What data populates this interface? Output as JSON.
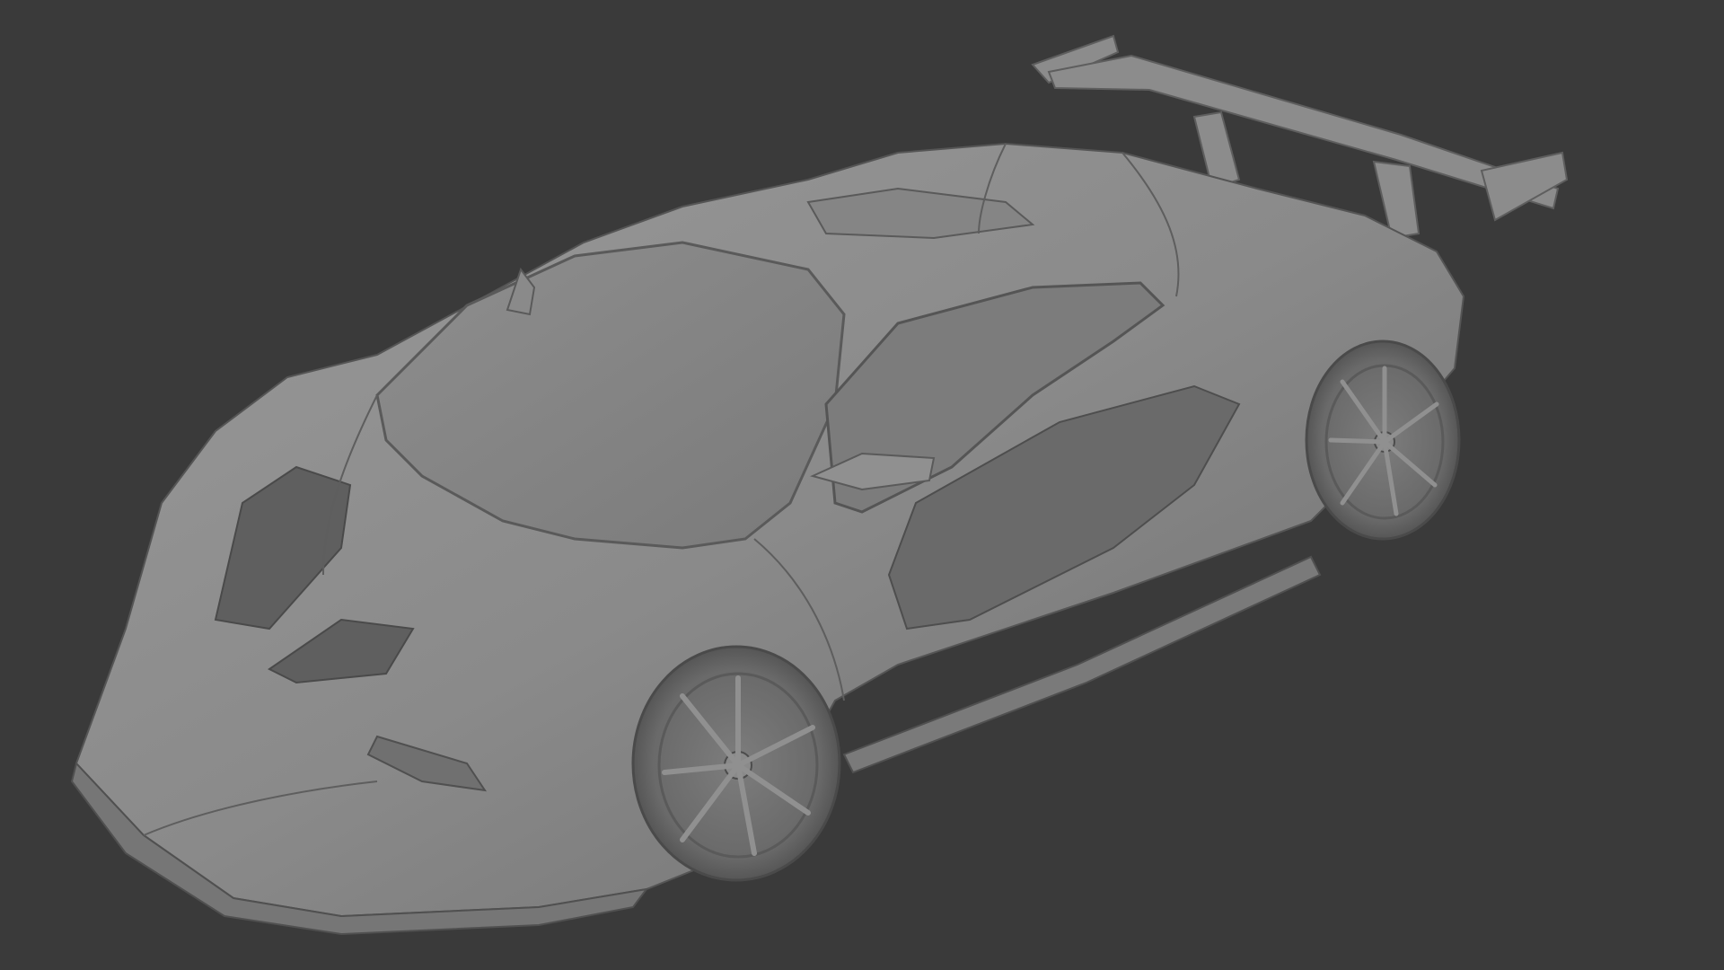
{
  "viewport": {
    "background_color": "#3a3a3a",
    "model_color": "#8a8a8a",
    "shading": "clay-matcap",
    "subject": "supercar-3d-model"
  }
}
